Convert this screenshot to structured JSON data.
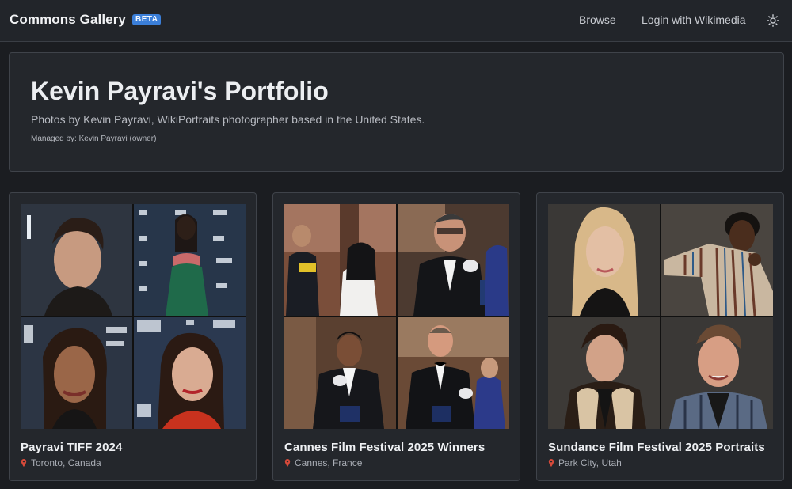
{
  "header": {
    "brand": "Commons Gallery",
    "badge": "BETA",
    "nav": {
      "browse": "Browse",
      "login": "Login with Wikimedia"
    },
    "theme_icon": "sun-icon"
  },
  "portfolio": {
    "title": "Kevin Payravi's Portfolio",
    "description": "Photos by Kevin Payravi, WikiPortraits photographer based in the United States.",
    "managed_by": "Managed by: Kevin Payravi (owner)"
  },
  "collections": [
    {
      "title": "Payravi TIFF 2024",
      "location": "Toronto, Canada",
      "icon": "location-pin-icon"
    },
    {
      "title": "Cannes Film Festival 2025 Winners",
      "location": "Cannes, France",
      "icon": "location-pin-icon"
    },
    {
      "title": "Sundance Film Festival 2025 Portraits",
      "location": "Park City, Utah",
      "icon": "location-pin-icon"
    }
  ],
  "colors": {
    "background": "#1b1d21",
    "panel": "#24272c",
    "accent": "#3b7fd9",
    "pin": "#d84a3a"
  }
}
